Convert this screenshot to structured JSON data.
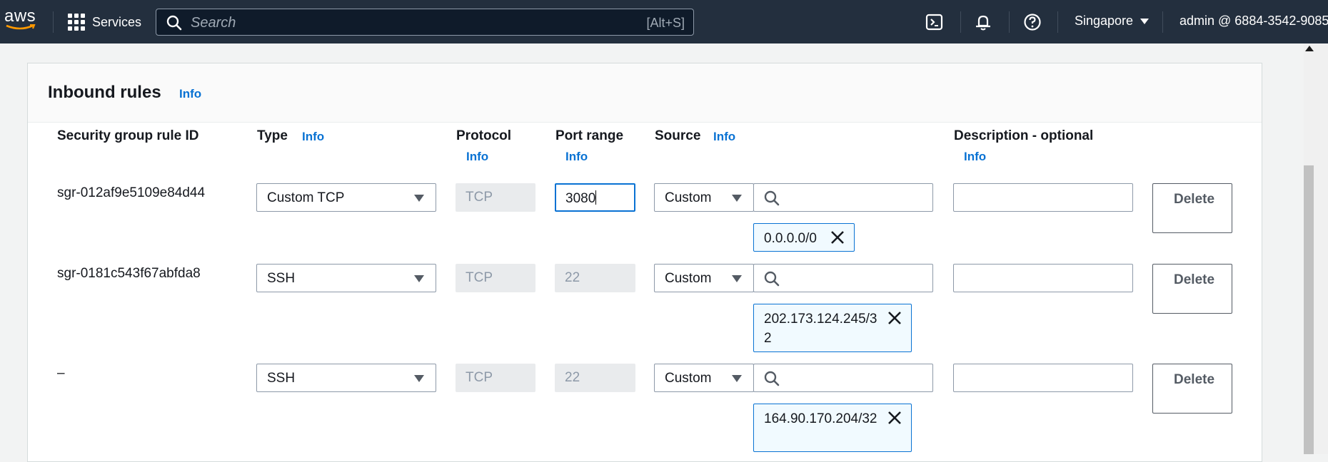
{
  "nav": {
    "logo": "aws",
    "services_label": "Services",
    "search_placeholder": "Search",
    "search_shortcut": "[Alt+S]",
    "region": "Singapore",
    "account": "admin @ 6884-3542-9085"
  },
  "panel": {
    "title": "Inbound rules",
    "info": "Info"
  },
  "columns": {
    "rule_id": "Security group rule ID",
    "type": "Type",
    "protocol": "Protocol",
    "port_range": "Port range",
    "source": "Source",
    "description": "Description - optional",
    "info": "Info"
  },
  "rules": [
    {
      "rule_id": "sgr-012af9e5109e84d44",
      "type": "Custom TCP",
      "protocol": "TCP",
      "port_range": "3080",
      "source_mode": "Custom",
      "source_token": "0.0.0.0/0",
      "description": "",
      "delete_label": "Delete"
    },
    {
      "rule_id": "sgr-0181c543f67abfda8",
      "type": "SSH",
      "protocol": "TCP",
      "port_range": "22",
      "source_mode": "Custom",
      "source_token": "202.173.124.245/32",
      "description": "",
      "delete_label": "Delete"
    },
    {
      "rule_id": "–",
      "type": "SSH",
      "protocol": "TCP",
      "port_range": "22",
      "source_mode": "Custom",
      "source_token": "164.90.170.204/32",
      "description": "",
      "delete_label": "Delete"
    }
  ],
  "icons": {
    "services": "grid-icon",
    "search": "search-icon",
    "cloudshell": "terminal-icon",
    "notifications": "bell-icon",
    "help": "help-icon",
    "remove": "close-icon"
  }
}
